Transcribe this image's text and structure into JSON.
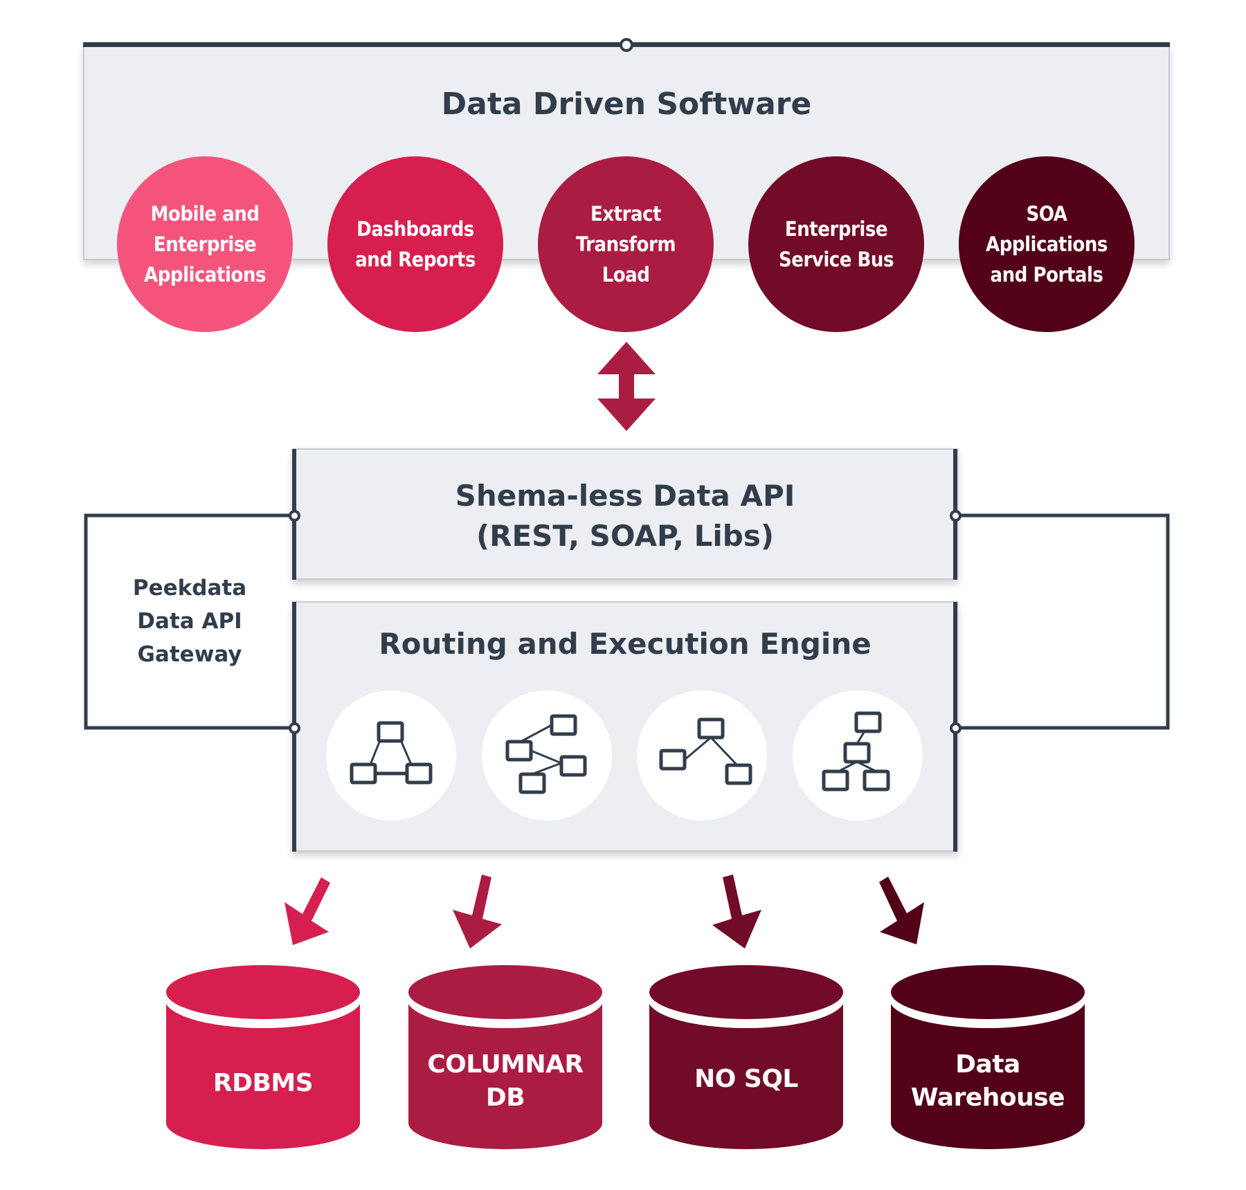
{
  "diagram": {
    "top_section": {
      "title": "Data Driven Software",
      "apps": [
        {
          "label": "Mobile and\nEnterprise\nApplications",
          "color": "#f4547c"
        },
        {
          "label": "Dashboards\nand Reports",
          "color": "#d61f4f"
        },
        {
          "label": "Extract\nTransform\nLoad",
          "color": "#ab1c43"
        },
        {
          "label": "Enterprise\nService Bus",
          "color": "#720b27"
        },
        {
          "label": "SOA\nApplications\nand Portals",
          "color": "#520119"
        }
      ]
    },
    "bidirectional_arrow": {
      "icon": "double-arrow-vertical-icon",
      "color": "#ab1c43"
    },
    "api_layer": {
      "title_line1": "Shema-less Data API",
      "title_line2": "(REST, SOAP, Libs)"
    },
    "engine_layer": {
      "title": "Routing and Execution Engine",
      "icons": [
        "network-triangle-icon",
        "network-branch-icon",
        "network-fork-icon",
        "network-tree-icon"
      ]
    },
    "gateway": {
      "label": "Peekdata\nData API\nGateway"
    },
    "data_stores": [
      {
        "label": "RDBMS",
        "color": "#d61f4f"
      },
      {
        "label": "COLUMNAR\nDB",
        "color": "#ab1c43"
      },
      {
        "label": "NO SQL",
        "color": "#720b27"
      },
      {
        "label": "Data\nWarehouse",
        "color": "#520119"
      }
    ],
    "colors": {
      "dark_line": "#323d4b",
      "panel_bg": "#eceef2",
      "panel_border": "#c6ccd3"
    }
  }
}
